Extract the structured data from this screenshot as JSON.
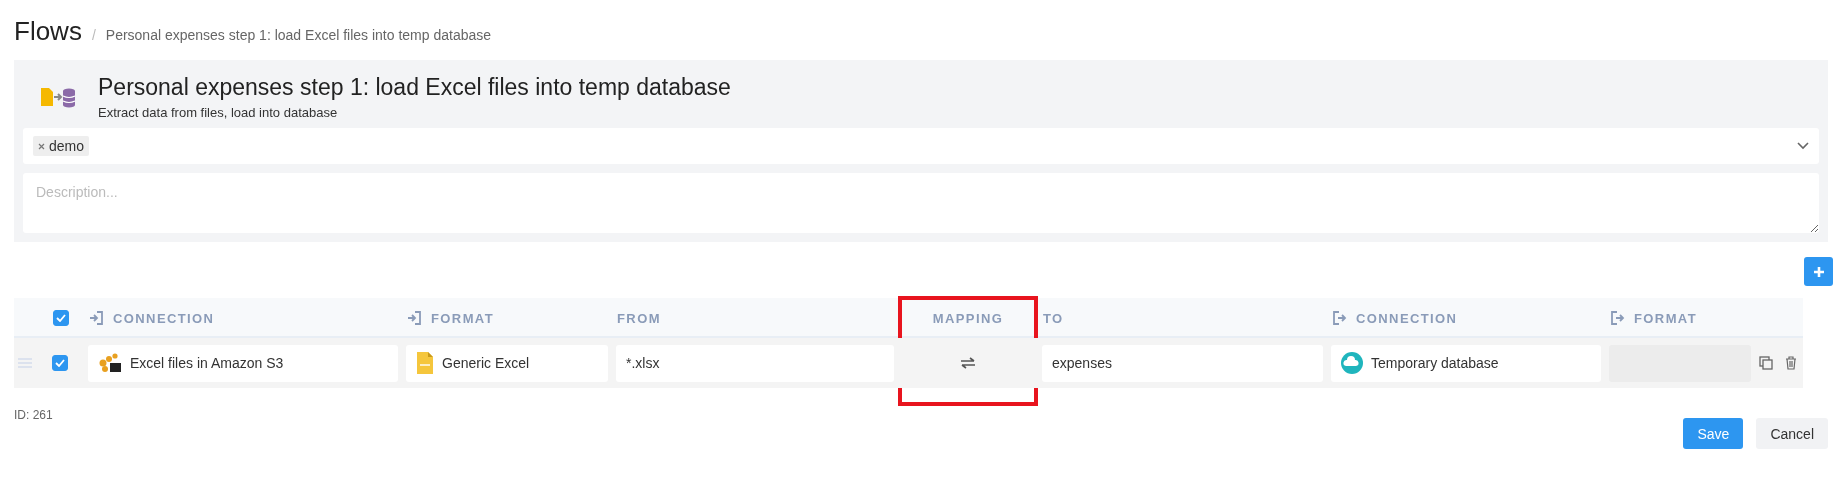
{
  "breadcrumb": {
    "root": "Flows",
    "separator": "/",
    "current": "Personal expenses step 1: load Excel files into temp database"
  },
  "flow": {
    "title": "Personal expenses step 1: load Excel files into temp database",
    "subtitle": "Extract data from files, load into database"
  },
  "tags": [
    {
      "label": "demo"
    }
  ],
  "description": {
    "placeholder": "Description..."
  },
  "table": {
    "select_all": {
      "checked": true
    },
    "columns": [
      {
        "label": "CONNECTION",
        "kind": "input",
        "highlighted": false
      },
      {
        "label": "FORMAT",
        "kind": "input",
        "highlighted": false
      },
      {
        "label": "FROM",
        "kind": "plain",
        "highlighted": false
      },
      {
        "label": "MAPPING",
        "kind": "center",
        "highlighted": true
      },
      {
        "label": "TO",
        "kind": "plain",
        "highlighted": false
      },
      {
        "label": "CONNECTION",
        "kind": "output",
        "highlighted": false
      },
      {
        "label": "FORMAT",
        "kind": "output",
        "highlighted": false
      }
    ],
    "rows": [
      {
        "checked": true,
        "source_connection": "Excel files in Amazon S3",
        "source_format": "Generic Excel",
        "from": "*.xlsx",
        "to": "expenses",
        "target_connection": "Temporary database"
      }
    ]
  },
  "id_label": "ID: 261",
  "buttons": [
    {
      "label": "Save",
      "kind": "primary"
    },
    {
      "label": "Cancel",
      "kind": "secondary"
    }
  ]
}
